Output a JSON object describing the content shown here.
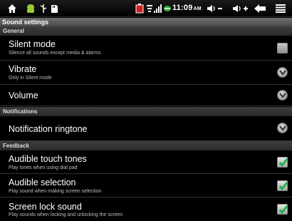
{
  "status": {
    "clock": "11:09",
    "ampm": "AM",
    "icons": [
      "home-icon",
      "android-debug-icon",
      "usb-icon",
      "sd-card-icon",
      "battery-low-icon",
      "wifi-icon",
      "signal-icon",
      "green-indicator-icon",
      "volume-down-icon",
      "volume-up-icon",
      "back-icon",
      "menu-icon"
    ]
  },
  "title": "Sound settings",
  "sections": {
    "general": "General",
    "notifications": "Notifications",
    "feedback": "Feedback"
  },
  "rows": {
    "silent": {
      "title": "Silent mode",
      "sub": "Silence all sounds except media & alarms",
      "checked": false
    },
    "vibrate": {
      "title": "Vibrate",
      "sub": "Only in Silent mode"
    },
    "volume": {
      "title": "Volume"
    },
    "ringtone": {
      "title": "Notification ringtone"
    },
    "touch_tones": {
      "title": "Audible touch tones",
      "sub": "Play tones when using dial pad",
      "checked": true
    },
    "selection": {
      "title": "Audible selection",
      "sub": "Play sound when making screen selection",
      "checked": true
    },
    "screen_lock": {
      "title": "Screen lock sound",
      "sub": "Play sounds when locking and unlocking the screen",
      "checked": true
    }
  },
  "colors": {
    "check_green": "#22b14c",
    "bg": "#000000"
  }
}
